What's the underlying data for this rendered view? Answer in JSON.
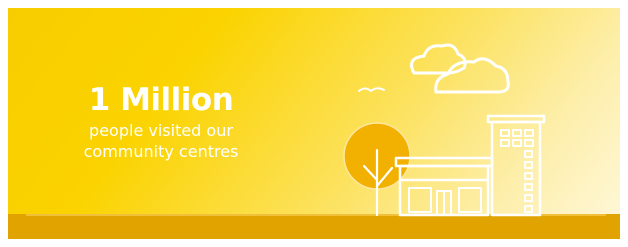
{
  "stat": {
    "value": "1 Million",
    "caption_line1": "people visited our",
    "caption_line2": "community centres"
  },
  "illustration": {
    "icons": [
      "cloud-icon",
      "bird-icon",
      "tree-icon",
      "building-icon",
      "apartment-tower-icon"
    ],
    "line_color": "#ffffff",
    "tree_color": "#f2b100",
    "ground_color": "#e1a300"
  },
  "colors": {
    "background_start": "#f8cd00",
    "background_end": "#fff8dc",
    "text": "#ffffff"
  }
}
